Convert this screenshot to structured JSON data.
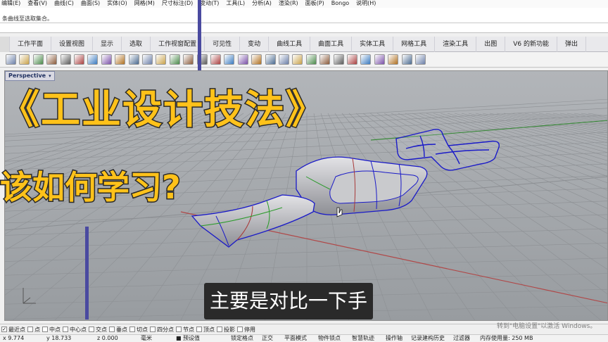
{
  "menu": [
    "编辑(E)",
    "查看(V)",
    "曲线(C)",
    "曲面(S)",
    "实体(O)",
    "网格(M)",
    "尺寸标注(D)",
    "变动(T)",
    "工具(L)",
    "分析(A)",
    "渲染(R)",
    "面板(P)",
    "Bongo",
    "说明(H)"
  ],
  "command_history": {
    "line2": "条曲线至选取集合。"
  },
  "tabs": [
    "工作平面",
    "设置视图",
    "显示",
    "选取",
    "工作视窗配置",
    "可见性",
    "变动",
    "曲线工具",
    "曲面工具",
    "实体工具",
    "网格工具",
    "渲染工具",
    "出图",
    "V6 的新功能",
    "弹出"
  ],
  "viewport": {
    "label": "Perspective",
    "dropdown_glyph": "▾"
  },
  "overlay": {
    "title": "《工业设计技法》",
    "question": "该如何学习?",
    "subtitle": "主要是对比一下手"
  },
  "osnap": [
    {
      "label": "最近点",
      "checked": true
    },
    {
      "label": "点",
      "checked": false
    },
    {
      "label": "中点",
      "checked": false
    },
    {
      "label": "中心点",
      "checked": false
    },
    {
      "label": "交点",
      "checked": false
    },
    {
      "label": "垂点",
      "checked": false
    },
    {
      "label": "切点",
      "checked": false
    },
    {
      "label": "四分点",
      "checked": false
    },
    {
      "label": "节点",
      "checked": false
    },
    {
      "label": "顶点",
      "checked": false
    },
    {
      "label": "投影",
      "checked": false
    },
    {
      "label": "停用",
      "checked": false
    }
  ],
  "status": {
    "x": "9.774",
    "y": "18.733",
    "z": "0.000",
    "unit": "毫米",
    "layer": "预设值",
    "grid_snap": "锁定格点",
    "ortho": "正交",
    "planar": "平面模式",
    "osnap_toggle": "物件锁点",
    "smarttrack": "智慧轨迹",
    "gumball": "操作轴",
    "history": "记录建构历史",
    "filter": "过滤器",
    "memory": "内存使用量: 250 MB"
  },
  "watermark": "转到\"电脑设置\"以激活 Windows。",
  "icons": [
    "new-file-icon",
    "open-icon",
    "save-icon",
    "print-icon",
    "cut-icon",
    "copy-icon",
    "paste-icon",
    "undo-icon",
    "pan-icon",
    "rotate-view-icon",
    "zoom-icon",
    "zoom-window-icon",
    "zoom-extents-icon",
    "zoom-selected-icon",
    "rotate-icon",
    "four-views-icon",
    "car-icon",
    "set-cplane-icon",
    "named-cplane-icon",
    "ghosted-icon",
    "select-lasso-icon",
    "light-icon",
    "render-icon",
    "material-icon",
    "environment-icon",
    "shaded-sphere-icon",
    "rendered-sphere-icon",
    "gear-icon",
    "properties-icon",
    "layer-icon",
    "options-icon"
  ]
}
